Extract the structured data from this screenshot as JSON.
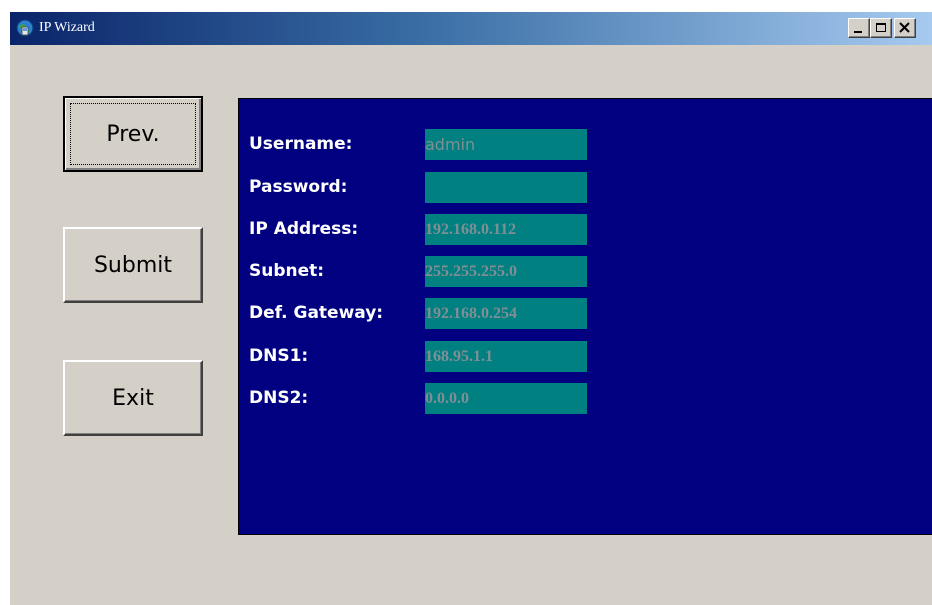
{
  "window": {
    "title": "IP Wizard",
    "icon": "network-globe-icon"
  },
  "title_buttons": {
    "minimize": "minimize-icon",
    "maximize": "maximize-icon",
    "close": "close-icon"
  },
  "buttons": {
    "prev": "Prev.",
    "submit": "Submit",
    "exit": "Exit"
  },
  "form": {
    "fields": [
      {
        "label": "Username:",
        "value": "admin"
      },
      {
        "label": "Password:",
        "value": ""
      },
      {
        "label": "IP Address:",
        "value": "192.168.0.112"
      },
      {
        "label": "Subnet:",
        "value": "255.255.255.0"
      },
      {
        "label": "Def. Gateway:",
        "value": "192.168.0.254"
      },
      {
        "label": "DNS1:",
        "value": "168.95.1.1"
      },
      {
        "label": "DNS2:",
        "value": "0.0.0.0"
      }
    ]
  },
  "colors": {
    "panel_bg": "#000080",
    "field_bg": "#008080",
    "window_bg": "#d4d0c8"
  }
}
